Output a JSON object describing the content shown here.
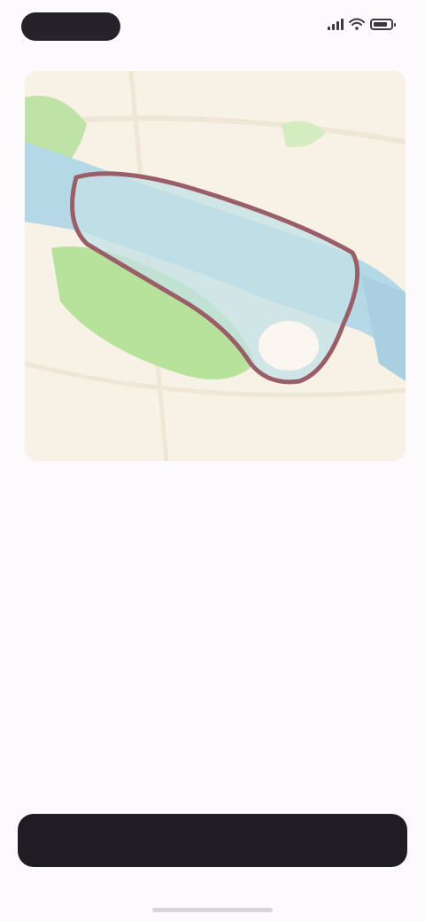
{
  "status_bar": {
    "time": "",
    "colors": {
      "pill": "#25222a",
      "icons": "#3a3840"
    }
  },
  "map": {
    "region_name": "",
    "colors": {
      "land": "#f7f1e6",
      "water": "#a9cfe0",
      "park": "#a8dc8e",
      "boundary": "#9a5e68"
    }
  },
  "content": {
    "description": "",
    "link_text": "",
    "subheading": ""
  },
  "actions": {
    "primary_label": "",
    "button_color": "#1f1c23"
  }
}
